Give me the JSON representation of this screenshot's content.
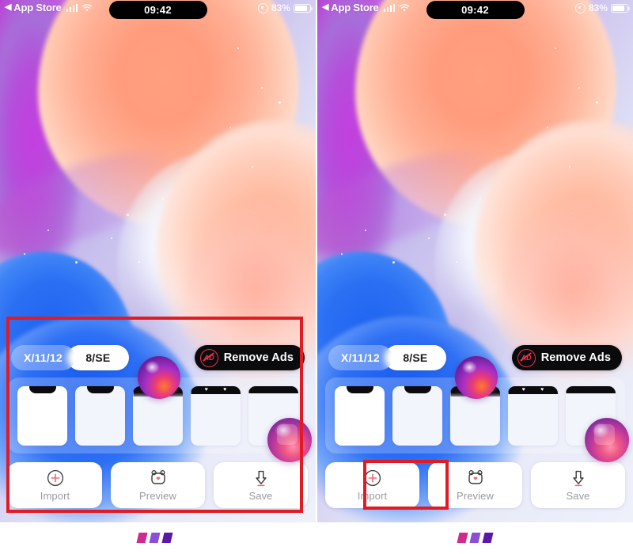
{
  "screen": {
    "status_bar": {
      "back_label": "App Store",
      "back_arrow": "◀",
      "time": "09:42",
      "battery_percent": "83%",
      "battery_level": 83,
      "signal_icon": "cellular-signal-icon",
      "wifi_icon": "wifi-icon",
      "location_icon": "location-services-icon",
      "battery_icon": "battery-icon"
    },
    "toolbar": {
      "segment": {
        "options": [
          "X/11/12",
          "8/SE"
        ],
        "inactive_label": "X/11/12",
        "active_label": "8/SE",
        "selected": "8/SE"
      },
      "remove_ads": {
        "label": "Remove Ads",
        "icon": "no-ads-icon",
        "icon_text": "AD"
      }
    },
    "thumbnails": [
      {
        "name": "thumb-notch-small",
        "style": "notch-small",
        "bright": true
      },
      {
        "name": "thumb-notch-small-2",
        "style": "notch-small",
        "bright": false
      },
      {
        "name": "thumb-bar-fade",
        "style": "bar-fade",
        "bright": false
      },
      {
        "name": "thumb-hearts",
        "style": "hearts",
        "bright": false,
        "hearts": [
          "♥",
          "♥"
        ]
      },
      {
        "name": "thumb-bar-plain",
        "style": "bar-plain",
        "bright": false
      }
    ],
    "actions": [
      {
        "label": "Import",
        "icon": "plus-circle-icon"
      },
      {
        "label": "Preview",
        "icon": "bear-face-heart-icon"
      },
      {
        "label": "Save",
        "icon": "download-arrow-icon"
      }
    ]
  },
  "annotations": {
    "left_panel_box": "full-app-ui-highlight",
    "right_panel_box": "import-button-highlight",
    "box_color": "#e01b24"
  },
  "footer_marks": {
    "count": 3,
    "colors": [
      "#cf2a8e",
      "#8a4fd6",
      "#5b17a8"
    ]
  },
  "theme": {
    "accent_red": "#e8324a",
    "pill_active_bg": "#ffffff",
    "pill_active_text": "#1c1c1e",
    "remove_ads_bg": "#0b0b0d",
    "label_gray": "#9a9aa2"
  }
}
